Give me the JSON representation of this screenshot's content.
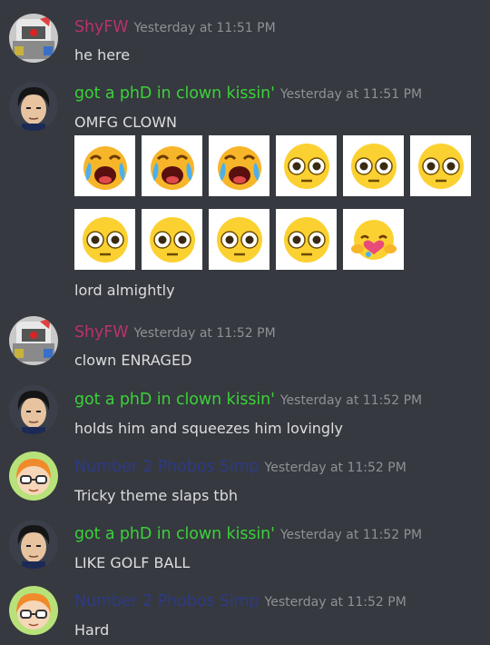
{
  "colors": {
    "background": "#36393f",
    "shyfw": "#b8336a",
    "clown": "#3bd13b",
    "phobos": "#2d3a86",
    "timestamp": "#8e9297",
    "text": "#dcddde"
  },
  "messages": [
    {
      "user": "ShyFW",
      "time": "Yesterday at 11:51 PM",
      "text": "he here",
      "avatar": "robot-mech-avatar"
    },
    {
      "user": "got a phD in clown kissin'",
      "time": "Yesterday at 11:51 PM",
      "text": "OMFG CLOWN",
      "avatar": "anime-boy-avatar",
      "emoji_rows": [
        [
          "crying-face",
          "crying-face",
          "crying-face",
          "flushed-face",
          "flushed-face",
          "flushed-face"
        ],
        [
          "flushed-face",
          "flushed-face",
          "flushed-face",
          "flushed-face",
          "hugging-heart-face"
        ]
      ],
      "followup": "lord almightly"
    },
    {
      "user": "ShyFW",
      "time": "Yesterday at 11:52 PM",
      "text": "clown ENRAGED",
      "avatar": "robot-mech-avatar"
    },
    {
      "user": "got a phD in clown kissin'",
      "time": "Yesterday at 11:52 PM",
      "text": "holds him and squeezes him lovingly",
      "avatar": "anime-boy-avatar"
    },
    {
      "user": "Number 2 Phobos Simp",
      "time": "Yesterday at 11:52 PM",
      "text": "Tricky theme slaps tbh",
      "avatar": "orange-hair-glasses-avatar"
    },
    {
      "user": "got a phD in clown kissin'",
      "time": "Yesterday at 11:52 PM",
      "text": "LIKE GOLF BALL",
      "avatar": "anime-boy-avatar"
    },
    {
      "user": "Number 2 Phobos Simp",
      "time": "Yesterday at 11:52 PM",
      "text": "Hard",
      "avatar": "orange-hair-glasses-avatar"
    }
  ]
}
